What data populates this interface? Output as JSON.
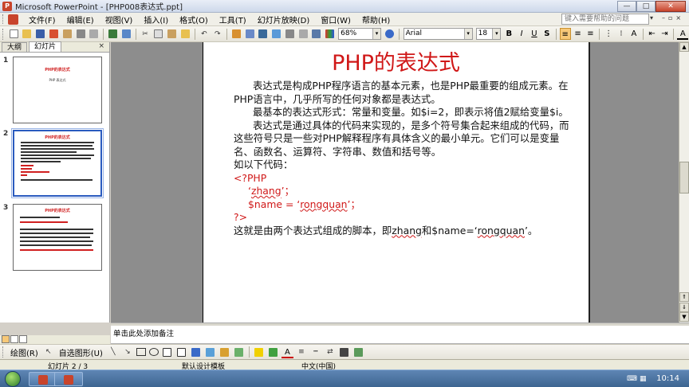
{
  "window": {
    "title": "Microsoft PowerPoint - [PHP008表达式.ppt]",
    "app_icon": "P"
  },
  "menu": {
    "items": [
      "文件(F)",
      "编辑(E)",
      "视图(V)",
      "插入(I)",
      "格式(O)",
      "工具(T)",
      "幻灯片放映(D)",
      "窗口(W)",
      "帮助(H)"
    ],
    "help_placeholder": "键入需要帮助的问题"
  },
  "toolbar": {
    "zoom": "68%",
    "font": "Arial",
    "size": "18",
    "bold": "B",
    "italic": "I",
    "underline": "U",
    "shadow": "S"
  },
  "left_pane": {
    "tab_outline": "大纲",
    "tab_slides": "幻灯片",
    "close": "×",
    "thumbs": [
      {
        "num": "1",
        "title": "PHP的表达式",
        "sub": "PHP 表达式"
      },
      {
        "num": "2",
        "title": "PHP的表达式"
      },
      {
        "num": "3",
        "title": "PHP的表达式"
      }
    ]
  },
  "slide": {
    "title": "PHP的表达式",
    "para1": "表达式是构成PHP程序语言的基本元素，也是PHP最重要的组成元素。在PHP语言中，几乎所写的任何对象都是表达式。",
    "para2": "最基本的表达式形式：常量和变量。如$i=2，即表示将值2赋给变量$i。",
    "para3": "表达式是通过具体的代码来实现的，是多个符号集合起来组成的代码，而这些符号只是一些对PHP解释程序有具体含义的最小单元。它们可以是变量名、函数名、运算符、字符串、数值和括号等。",
    "para4": "如以下代码：",
    "code_open": "<?PHP",
    "code1_pre": "‘",
    "code1_word": "zhang",
    "code1_post": "’；",
    "code2_pre": "$name = ‘",
    "code2_word": "rongquan",
    "code2_post": "’；",
    "code_close": "?>",
    "last_pre": "这就是由两个表达式组成的脚本，即",
    "last_word1": "zhang",
    "last_mid": "和$name=‘",
    "last_word2": "rongquan",
    "last_post": "’。"
  },
  "notes": {
    "placeholder": "单击此处添加备注"
  },
  "drawbar": {
    "draw": "绘图(R)",
    "autoshapes": "自选图形(U)"
  },
  "status": {
    "slide": "幻灯片 2 / 3",
    "design": "默认设计模板",
    "lang": "中文(中国)"
  },
  "taskbar": {
    "clock": "10:14"
  }
}
